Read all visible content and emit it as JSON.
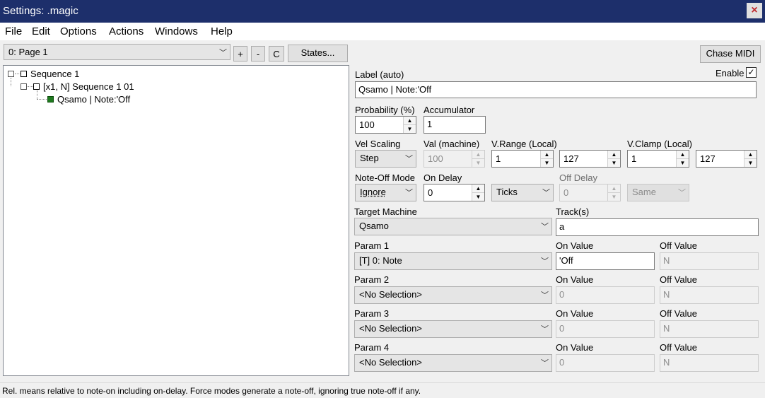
{
  "window": {
    "title": "Settings: .magic",
    "close_icon": "×"
  },
  "menu": [
    "File",
    "Edit",
    "Options",
    "Actions",
    "Windows",
    "Help"
  ],
  "toolbar": {
    "page_select": "0: Page 1",
    "add_label": "+",
    "remove_label": "-",
    "c_label": "C",
    "states_label": "States...",
    "chase_midi_label": "Chase MIDI"
  },
  "tree": {
    "root": "Sequence 1",
    "child": "[x1, N] Sequence 1 01",
    "leaf": "Qsamo | Note:'Off"
  },
  "form": {
    "label_caption": "Label (auto)",
    "label_value": "Qsamo | Note:'Off",
    "enable_label": "Enable",
    "enable_checked": "✓",
    "probability_caption": "Probability (%)",
    "probability_value": "100",
    "accumulator_caption": "Accumulator",
    "accumulator_value": "1",
    "vel_scaling_caption": "Vel Scaling",
    "vel_scaling_value": "Step",
    "val_machine_caption": "Val (machine)",
    "val_machine_value": "100",
    "vrange_caption": "V.Range (Local)",
    "vrange_min": "1",
    "vrange_max": "127",
    "vclamp_caption": "V.Clamp (Local)",
    "vclamp_min": "1",
    "vclamp_max": "127",
    "noteoff_mode_caption": "Note-Off Mode",
    "noteoff_mode_value": "Ignore",
    "on_delay_caption": "On Delay",
    "on_delay_value": "0",
    "on_delay_unit": "Ticks",
    "off_delay_caption": "Off Delay",
    "off_delay_value": "0",
    "off_delay_unit": "Same",
    "target_machine_caption": "Target Machine",
    "target_machine_value": "Qsamo",
    "tracks_caption": "Track(s)",
    "tracks_value": "a",
    "on_value_caption": "On Value",
    "off_value_caption": "Off Value",
    "params": [
      {
        "caption": "Param 1",
        "value": "[T] 0: Note",
        "on": "'Off",
        "off": "N"
      },
      {
        "caption": "Param 2",
        "value": "<No Selection>",
        "on": "0",
        "off": "N"
      },
      {
        "caption": "Param 3",
        "value": "<No Selection>",
        "on": "0",
        "off": "N"
      },
      {
        "caption": "Param 4",
        "value": "<No Selection>",
        "on": "0",
        "off": "N"
      }
    ]
  },
  "status": "Rel. means relative to note-on including on-delay. Force modes generate a note-off, ignoring true note-off if any."
}
